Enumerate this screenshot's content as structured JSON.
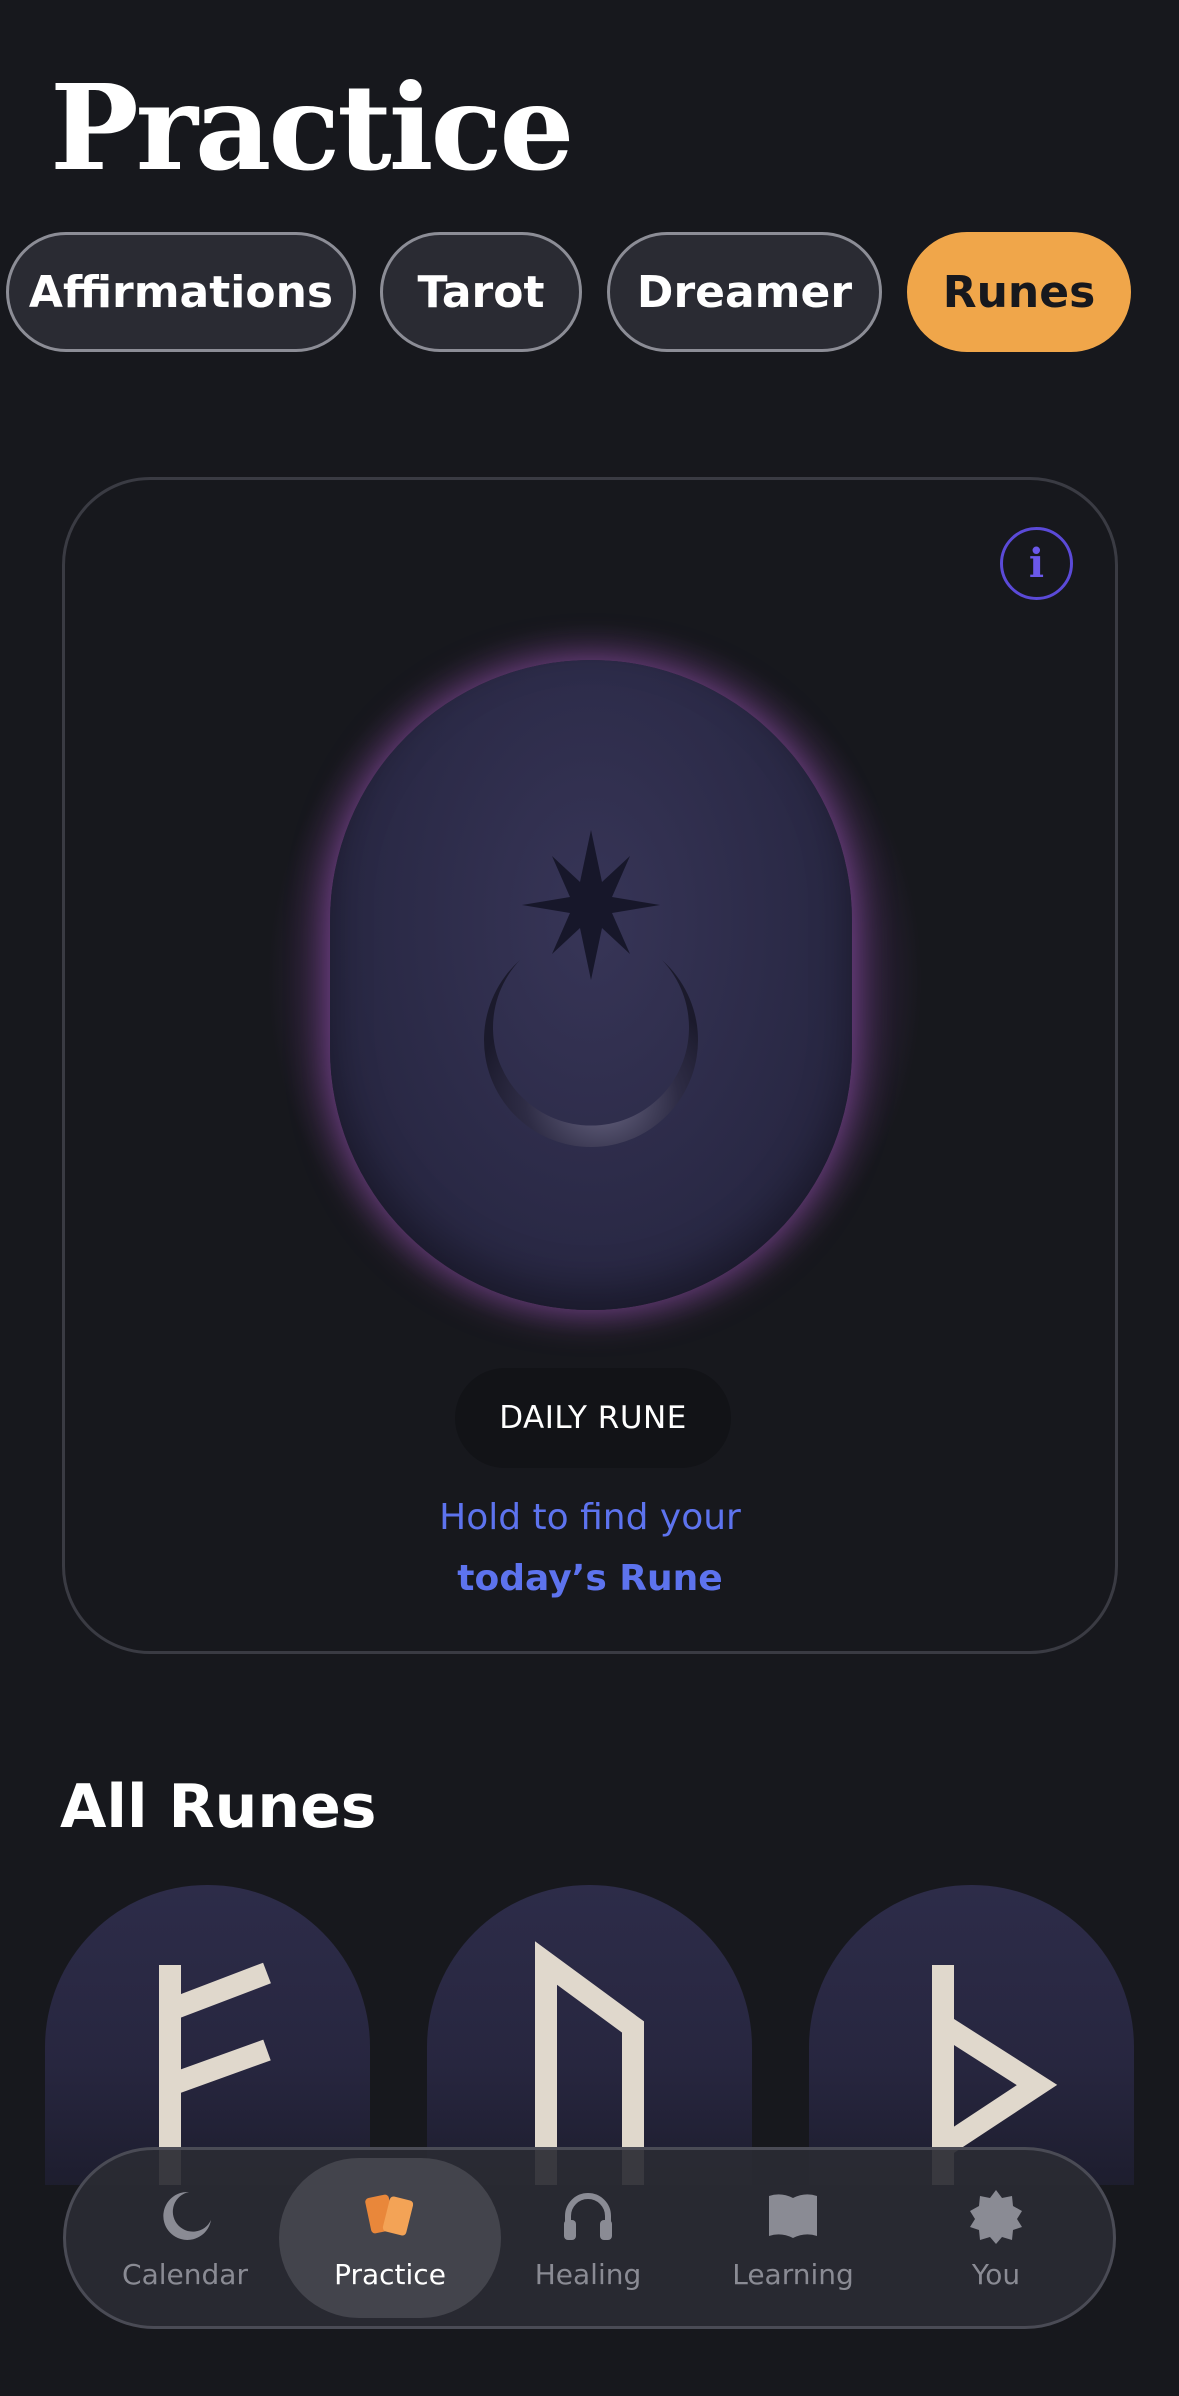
{
  "page": {
    "title": "Practice"
  },
  "tabs": [
    {
      "label": "Affirmations",
      "active": false
    },
    {
      "label": "Tarot",
      "active": false
    },
    {
      "label": "Dreamer",
      "active": false
    },
    {
      "label": "Runes",
      "active": true
    }
  ],
  "daily_card": {
    "info_label": "i",
    "badge": "DAILY RUNE",
    "hint_line1": "Hold to find your",
    "hint_line2": "today’s Rune"
  },
  "all_runes": {
    "title": "All Runes",
    "items": [
      {
        "icon": "fehu-rune-icon"
      },
      {
        "icon": "uruz-rune-icon"
      },
      {
        "icon": "thurisaz-rune-icon"
      }
    ]
  },
  "nav": {
    "items": [
      {
        "label": "Calendar",
        "icon": "moon-icon",
        "active": false
      },
      {
        "label": "Practice",
        "icon": "cards-icon",
        "active": true
      },
      {
        "label": "Healing",
        "icon": "headphones-icon",
        "active": false
      },
      {
        "label": "Learning",
        "icon": "book-icon",
        "active": false
      },
      {
        "label": "You",
        "icon": "badge-icon",
        "active": false
      }
    ]
  },
  "colors": {
    "background": "#17181d",
    "accent_orange": "#f0a64a",
    "accent_blue": "#5d73ee",
    "glow_purple": "#aa55c8"
  }
}
